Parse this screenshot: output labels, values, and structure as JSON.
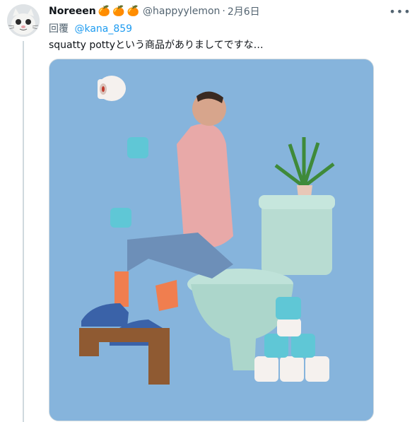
{
  "tweet": {
    "display_name": "Noreeen",
    "badges": [
      "🍊",
      "🍊",
      "🍊"
    ],
    "handle": "@happyylemon",
    "separator": "·",
    "date": "2月6日",
    "more_label": "•••",
    "reply_label": "回覆",
    "reply_mention": "@kana_859",
    "text": "squatty pottyという商品がありましてですな…"
  },
  "media": {
    "description_icon": "photo",
    "bg_color": "#86b4dc"
  },
  "colors": {
    "link": "#1d9bf0",
    "secondary": "#536471"
  }
}
